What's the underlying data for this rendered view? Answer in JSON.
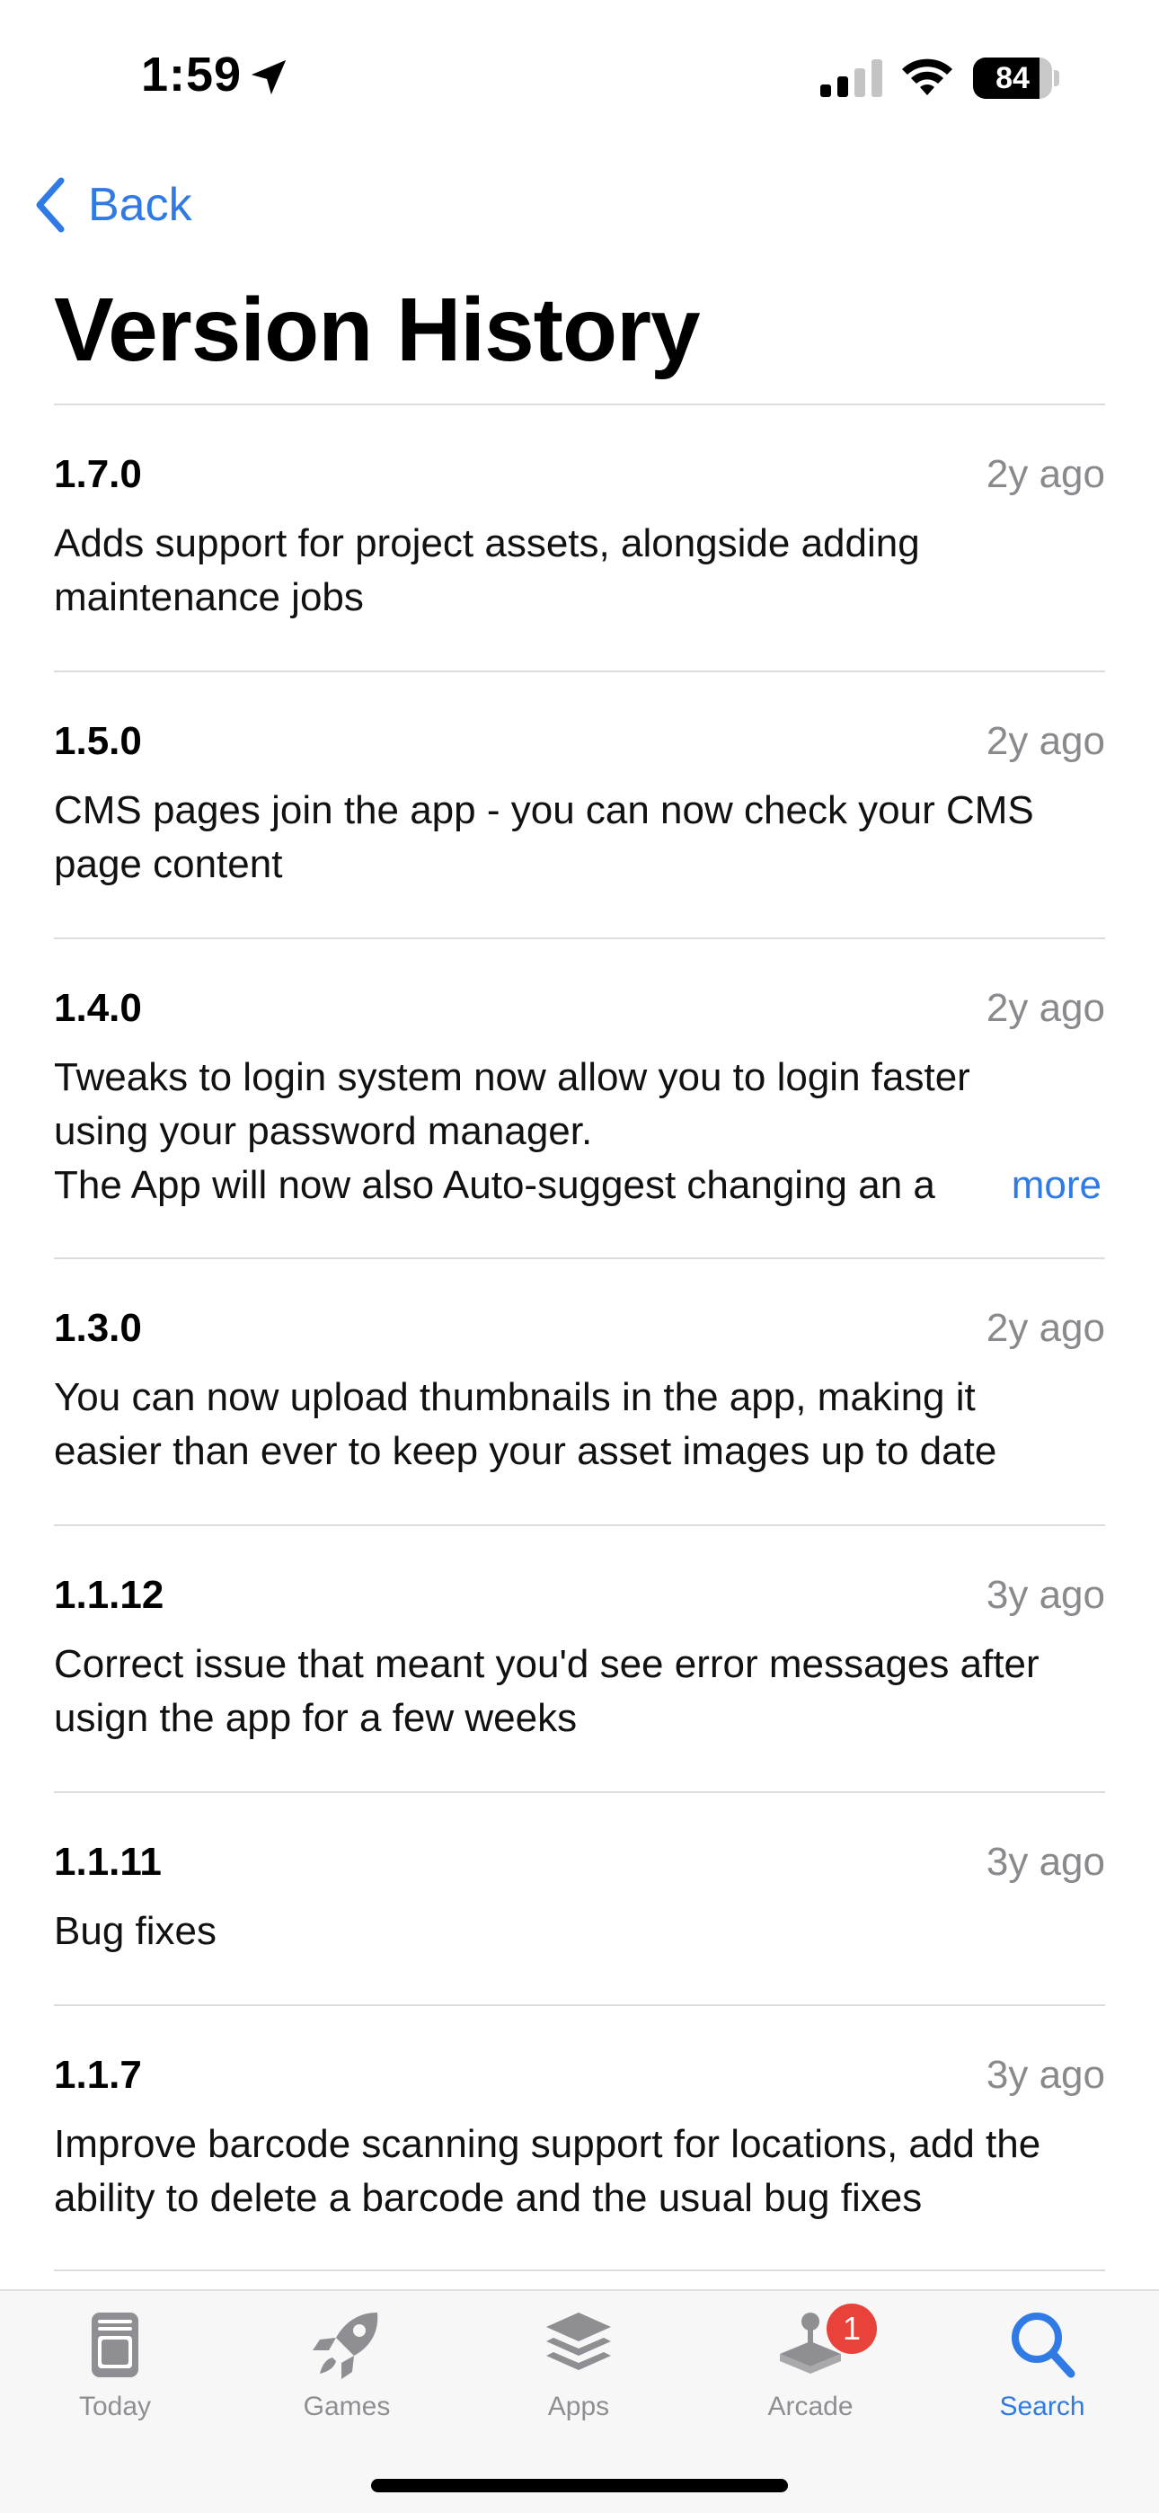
{
  "status_bar": {
    "time": "1:59",
    "battery_percent": "84",
    "battery_level": 0.84
  },
  "nav": {
    "back_label": "Back"
  },
  "page": {
    "title": "Version History"
  },
  "versions": [
    {
      "version": "1.7.0",
      "date": "2y ago",
      "notes": "Adds support for project assets, alongside adding\nmaintenance jobs"
    },
    {
      "version": "1.5.0",
      "date": "2y ago",
      "notes": "CMS pages join the app - you can now check your CMS\npage content"
    },
    {
      "version": "1.4.0",
      "date": "2y ago",
      "notes": "Tweaks to login system now allow you to login faster\nusing your password manager.\nThe App will now also Auto-suggest changing an a",
      "more_label": "more"
    },
    {
      "version": "1.3.0",
      "date": "2y ago",
      "notes": "You can now upload thumbnails in the app, making it\neasier than ever to keep your asset images up to date"
    },
    {
      "version": "1.1.12",
      "date": "3y ago",
      "notes": "Correct issue that meant you'd see error messages after\nusign the app for a few weeks"
    },
    {
      "version": "1.1.11",
      "date": "3y ago",
      "notes": "Bug fixes"
    },
    {
      "version": "1.1.7",
      "date": "3y ago",
      "notes": "Improve barcode scanning support for locations, add the\nability to delete a barcode and the usual bug fixes"
    }
  ],
  "tab_bar": {
    "tabs": [
      {
        "label": "Today",
        "icon": "today-icon"
      },
      {
        "label": "Games",
        "icon": "rocket-icon"
      },
      {
        "label": "Apps",
        "icon": "layers-icon"
      },
      {
        "label": "Arcade",
        "icon": "joystick-icon",
        "badge": "1"
      },
      {
        "label": "Search",
        "icon": "search-icon",
        "active": true
      }
    ]
  },
  "colors": {
    "accent": "#2f7ae5",
    "badge": "#e8423a",
    "secondary_text": "#8a8a8e"
  }
}
